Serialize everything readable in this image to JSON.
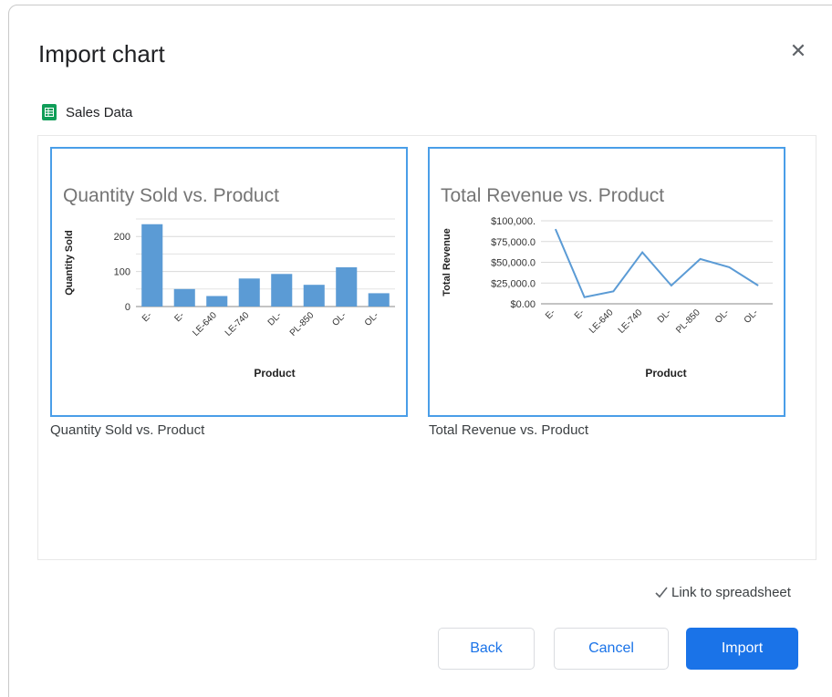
{
  "dialog": {
    "title": "Import chart",
    "close_icon": "close-icon",
    "source_name": "Sales Data",
    "source_icon": "google-sheets-icon",
    "link_label": "Link to spreadsheet",
    "link_checked": true,
    "buttons": {
      "back": "Back",
      "cancel": "Cancel",
      "import": "Import"
    },
    "colors": {
      "accent": "#1a73e8",
      "selection_border": "#4a9ee8",
      "chart_series": "#5b9bd5",
      "sheets_green": "#0f9d58"
    }
  },
  "charts": [
    {
      "caption": "Quantity Sold vs. Product"
    },
    {
      "caption": "Total Revenue vs. Product"
    }
  ],
  "chart_data": [
    {
      "type": "bar",
      "title": "Quantity Sold vs. Product",
      "xlabel": "Product",
      "ylabel": "Quantity Sold",
      "categories": [
        "E-",
        "E-",
        "LE-640",
        "LE-740",
        "DL-",
        "PL-850",
        "OL-",
        "OL-"
      ],
      "values": [
        235,
        50,
        30,
        80,
        93,
        62,
        112,
        38
      ],
      "yticks": [
        "0",
        "100",
        "200"
      ],
      "ylim": [
        0,
        250
      ],
      "grid": true
    },
    {
      "type": "line",
      "title": "Total Revenue vs. Product",
      "xlabel": "Product",
      "ylabel": "Total Revenue",
      "categories": [
        "E-",
        "E-",
        "LE-640",
        "LE-740",
        "DL-",
        "PL-850",
        "OL-",
        "OL-"
      ],
      "values": [
        90000,
        8000,
        15000,
        62000,
        22000,
        54000,
        44000,
        22000
      ],
      "yticks": [
        "$0.00",
        "$25,000.0",
        "$50,000.0",
        "$75,000.0",
        "$100,000."
      ],
      "ylim": [
        0,
        100000
      ],
      "grid": true
    }
  ]
}
